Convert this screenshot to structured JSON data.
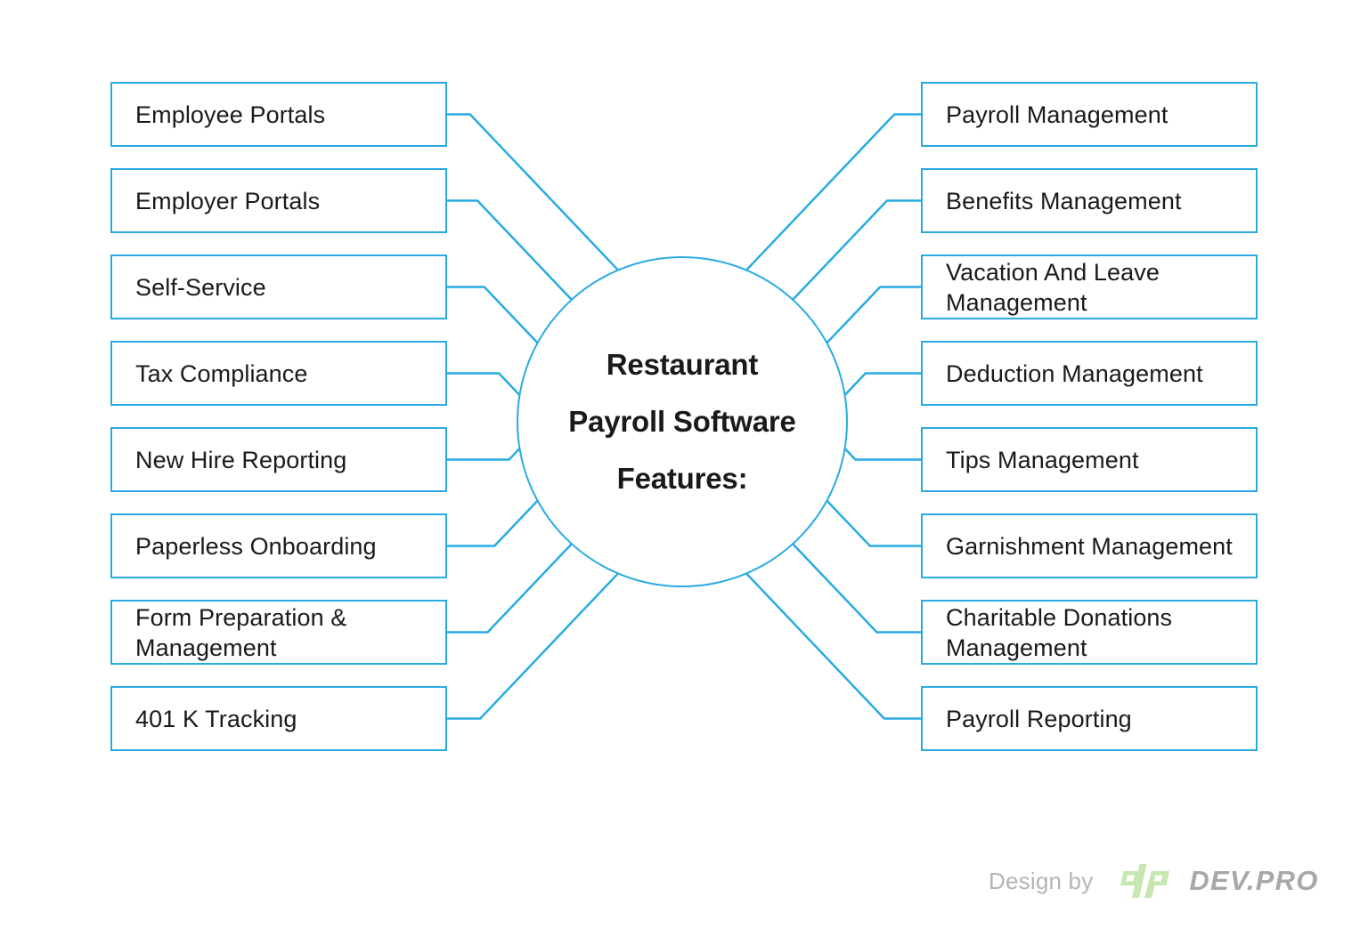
{
  "diagram": {
    "center": {
      "title": "Restaurant\nPayroll Software\nFeatures:"
    },
    "accent_color": "#29abe2",
    "text_color": "#1a1a1a",
    "left_items": [
      {
        "label": "Employee Portals"
      },
      {
        "label": "Employer Portals"
      },
      {
        "label": "Self-Service"
      },
      {
        "label": "Tax Compliance"
      },
      {
        "label": "New Hire Reporting"
      },
      {
        "label": "Paperless Onboarding"
      },
      {
        "label": "Form Preparation &\nManagement"
      },
      {
        "label": "401 K Tracking"
      }
    ],
    "right_items": [
      {
        "label": "Payroll Management"
      },
      {
        "label": "Benefits Management"
      },
      {
        "label": "Vacation And Leave\nManagement"
      },
      {
        "label": "Deduction Management"
      },
      {
        "label": "Tips Management"
      },
      {
        "label": "Garnishment Management"
      },
      {
        "label": "Charitable Donations\nManagement"
      },
      {
        "label": "Payroll Reporting"
      }
    ]
  },
  "credit": {
    "text": "Design by",
    "logo_mark": "dp",
    "logo_word": "DEV.PRO",
    "logo_mark_color": "#c6e6b2",
    "logo_word_color": "#a8a8a8"
  }
}
